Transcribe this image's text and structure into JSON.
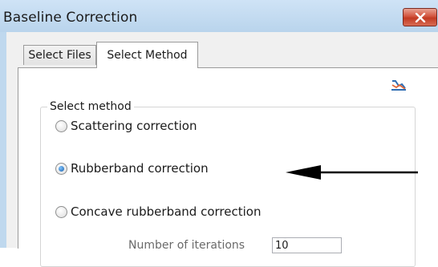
{
  "window": {
    "title": "Baseline Correction",
    "close_icon": "close-x-icon"
  },
  "tabs": [
    {
      "label": "Select Files",
      "active": false
    },
    {
      "label": "Select Method",
      "active": true
    }
  ],
  "method_group": {
    "legend": "Select method",
    "options": [
      {
        "label": "Scattering correction",
        "selected": false
      },
      {
        "label": "Rubberband correction",
        "selected": true
      },
      {
        "label": "Concave rubberband correction",
        "selected": false
      }
    ]
  },
  "iterations": {
    "label": "Number of iterations",
    "value": "10"
  },
  "annotation": {
    "icon": "left-arrow-icon",
    "color": "#000000"
  },
  "colors": {
    "title_bar": "#bfd8ee",
    "close_button": "#c7432b",
    "radio_selected": "#1a5fa8"
  }
}
